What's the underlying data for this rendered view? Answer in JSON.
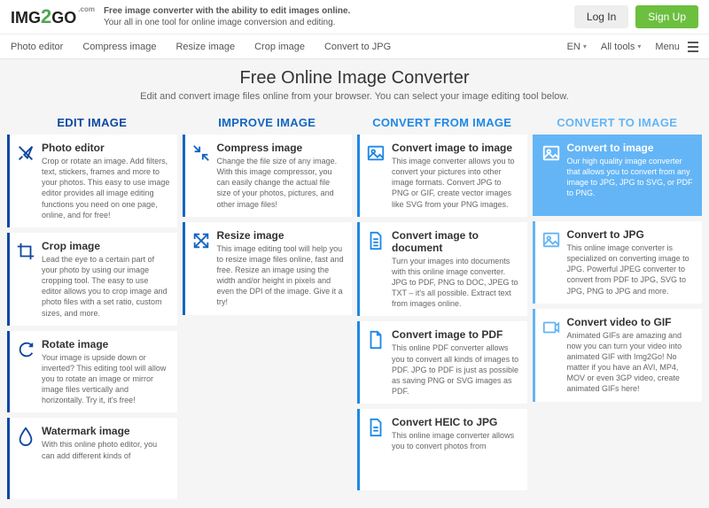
{
  "header": {
    "logo": {
      "img": "IMG",
      "two": "2",
      "go": "GO",
      "tld": ".com"
    },
    "tagline_main": "Free image converter with the ability to edit images online.",
    "tagline_sub": "Your all in one tool for online image conversion and editing.",
    "login": "Log In",
    "signup": "Sign Up"
  },
  "subnav": {
    "items": [
      "Photo editor",
      "Compress image",
      "Resize image",
      "Crop image",
      "Convert to JPG"
    ],
    "lang": "EN",
    "alltools": "All tools",
    "menu": "Menu"
  },
  "hero": {
    "title": "Free Online Image Converter",
    "subtitle": "Edit and convert image files online from your browser. You can select your image editing tool below."
  },
  "columns": {
    "edit": {
      "header": "EDIT IMAGE",
      "cards": [
        {
          "title": "Photo editor",
          "desc": "Crop or rotate an image. Add filters, text, stickers, frames and more to your photos. This easy to use image editor provides all image editing functions you need on one page, online, and for free!",
          "icon": "brush"
        },
        {
          "title": "Crop image",
          "desc": "Lead the eye to a certain part of your photo by using our image cropping tool. The easy to use editor allows you to crop image and photo files with a set ratio, custom sizes, and more.",
          "icon": "crop"
        },
        {
          "title": "Rotate image",
          "desc": "Your image is upside down or inverted? This editing tool will allow you to rotate an image or mirror image files vertically and horizontally. Try it, it's free!",
          "icon": "rotate"
        },
        {
          "title": "Watermark image",
          "desc": "With this online photo editor, you can add different kinds of",
          "icon": "water"
        }
      ]
    },
    "improve": {
      "header": "IMPROVE IMAGE",
      "cards": [
        {
          "title": "Compress image",
          "desc": "Change the file size of any image. With this image compressor, you can easily change the actual file size of your photos, pictures, and other image files!",
          "icon": "compress"
        },
        {
          "title": "Resize image",
          "desc": "This image editing tool will help you to resize image files online, fast and free. Resize an image using the width and/or height in pixels and even the DPI of the image. Give it a try!",
          "icon": "resize"
        }
      ]
    },
    "from": {
      "header": "CONVERT FROM IMAGE",
      "cards": [
        {
          "title": "Convert image to image",
          "desc": "This image converter allows you to convert your pictures into other image formats. Convert JPG to PNG or GIF, create vector images like SVG from your PNG images.",
          "icon": "image"
        },
        {
          "title": "Convert image to document",
          "desc": "Turn your images into documents with this online image converter. JPG to PDF, PNG to DOC, JPEG to TXT – it's all possible. Extract text from images online.",
          "icon": "doc"
        },
        {
          "title": "Convert image to PDF",
          "desc": "This online PDF converter allows you to convert all kinds of images to PDF. JPG to PDF is just as possible as saving PNG or SVG images as PDF.",
          "icon": "pdf"
        },
        {
          "title": "Convert HEIC to JPG",
          "desc": "This online image converter allows you to convert photos from",
          "icon": "doc"
        }
      ]
    },
    "to": {
      "header": "CONVERT TO IMAGE",
      "cards": [
        {
          "title": "Convert to image",
          "desc": "Our high quality image converter that allows you to convert from any image to JPG, JPG to SVG, or PDF to PNG.",
          "icon": "image",
          "active": true
        },
        {
          "title": "Convert to JPG",
          "desc": "This online image converter is specialized on converting image to JPG. Powerful JPEG converter to convert from PDF to JPG, SVG to JPG, PNG to JPG and more.",
          "icon": "image"
        },
        {
          "title": "Convert video to GIF",
          "desc": "Animated GIFs are amazing and now you can turn your video into animated GIF with Img2Go! No matter if you have an AVI, MP4, MOV or even 3GP video, create animated GIFs here!",
          "icon": "video"
        }
      ]
    }
  },
  "colors": {
    "edit": "#0d47a1",
    "improve": "#1565c0",
    "from": "#1e88e5",
    "to": "#64b5f6"
  }
}
